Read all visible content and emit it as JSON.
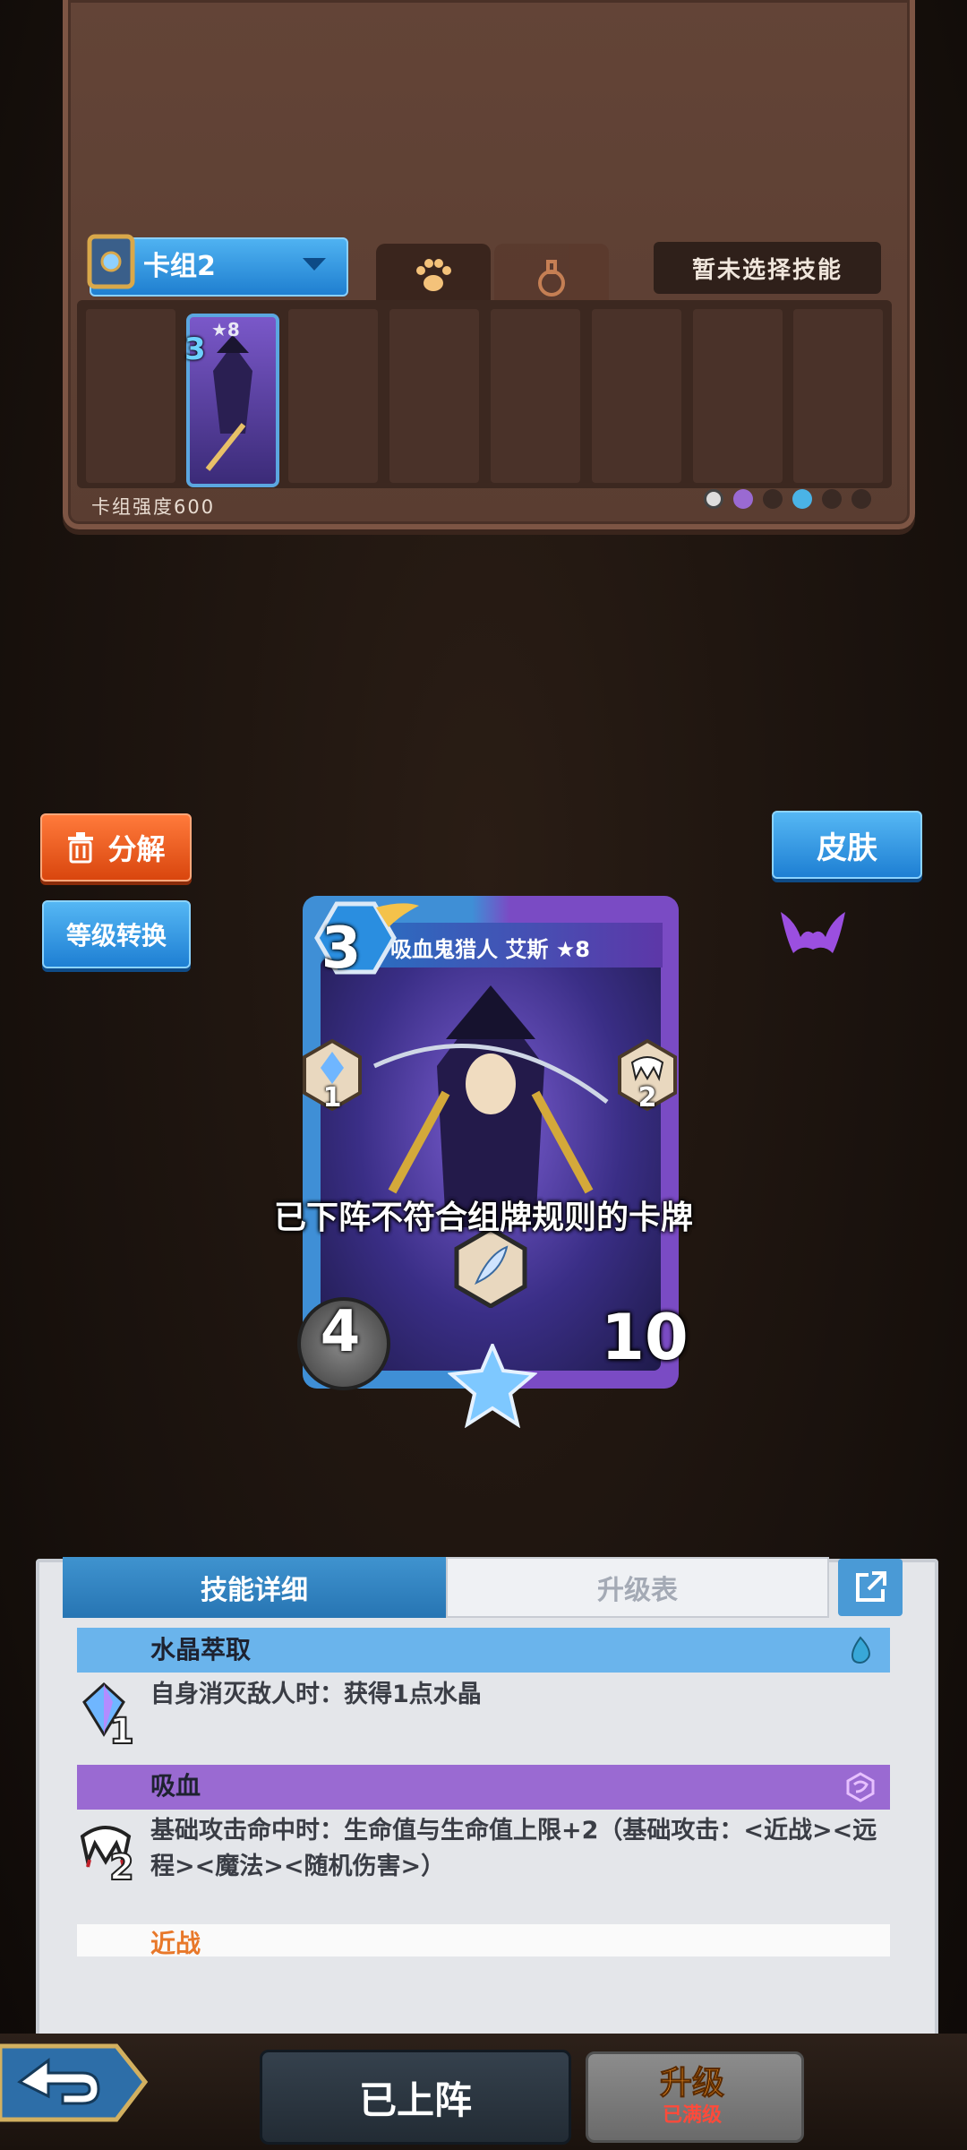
{
  "deck": {
    "name": "卡组2",
    "skill_button": "暂未选择技能",
    "strength_label": "卡组强度600",
    "mini_card": {
      "cost": "3",
      "star": "★8"
    }
  },
  "actions": {
    "decompose": "分解",
    "level_convert": "等级转换",
    "skin": "皮肤"
  },
  "card": {
    "cost": "3",
    "title": "吸血鬼猎人 艾斯 ★8",
    "badge_left": "1",
    "badge_right": "2",
    "attack": "4",
    "health": "10"
  },
  "toast": "已下阵不符合组牌规则的卡牌",
  "detail": {
    "tabs": [
      "技能详细",
      "升级表"
    ],
    "skills": [
      {
        "name": "水晶萃取",
        "level": "1",
        "desc": "自身消灭敌人时：获得1点水晶",
        "color": "#6ab4ec"
      },
      {
        "name": "吸血",
        "level": "2",
        "desc": "基础攻击命中时：生命值与生命值上限+2（基础攻击：<近战><远程><魔法><随机伤害>）",
        "color": "#9a6ad2"
      }
    ],
    "tag": "近战"
  },
  "bottom": {
    "deployed": "已上阵",
    "upgrade": "升级",
    "upgrade_sub": "已满级"
  },
  "colors": {
    "accent_blue": "#2f8ad8",
    "accent_orange": "#e4561a",
    "crystal": "#6ab4ec",
    "blood": "#9a6ad2"
  }
}
